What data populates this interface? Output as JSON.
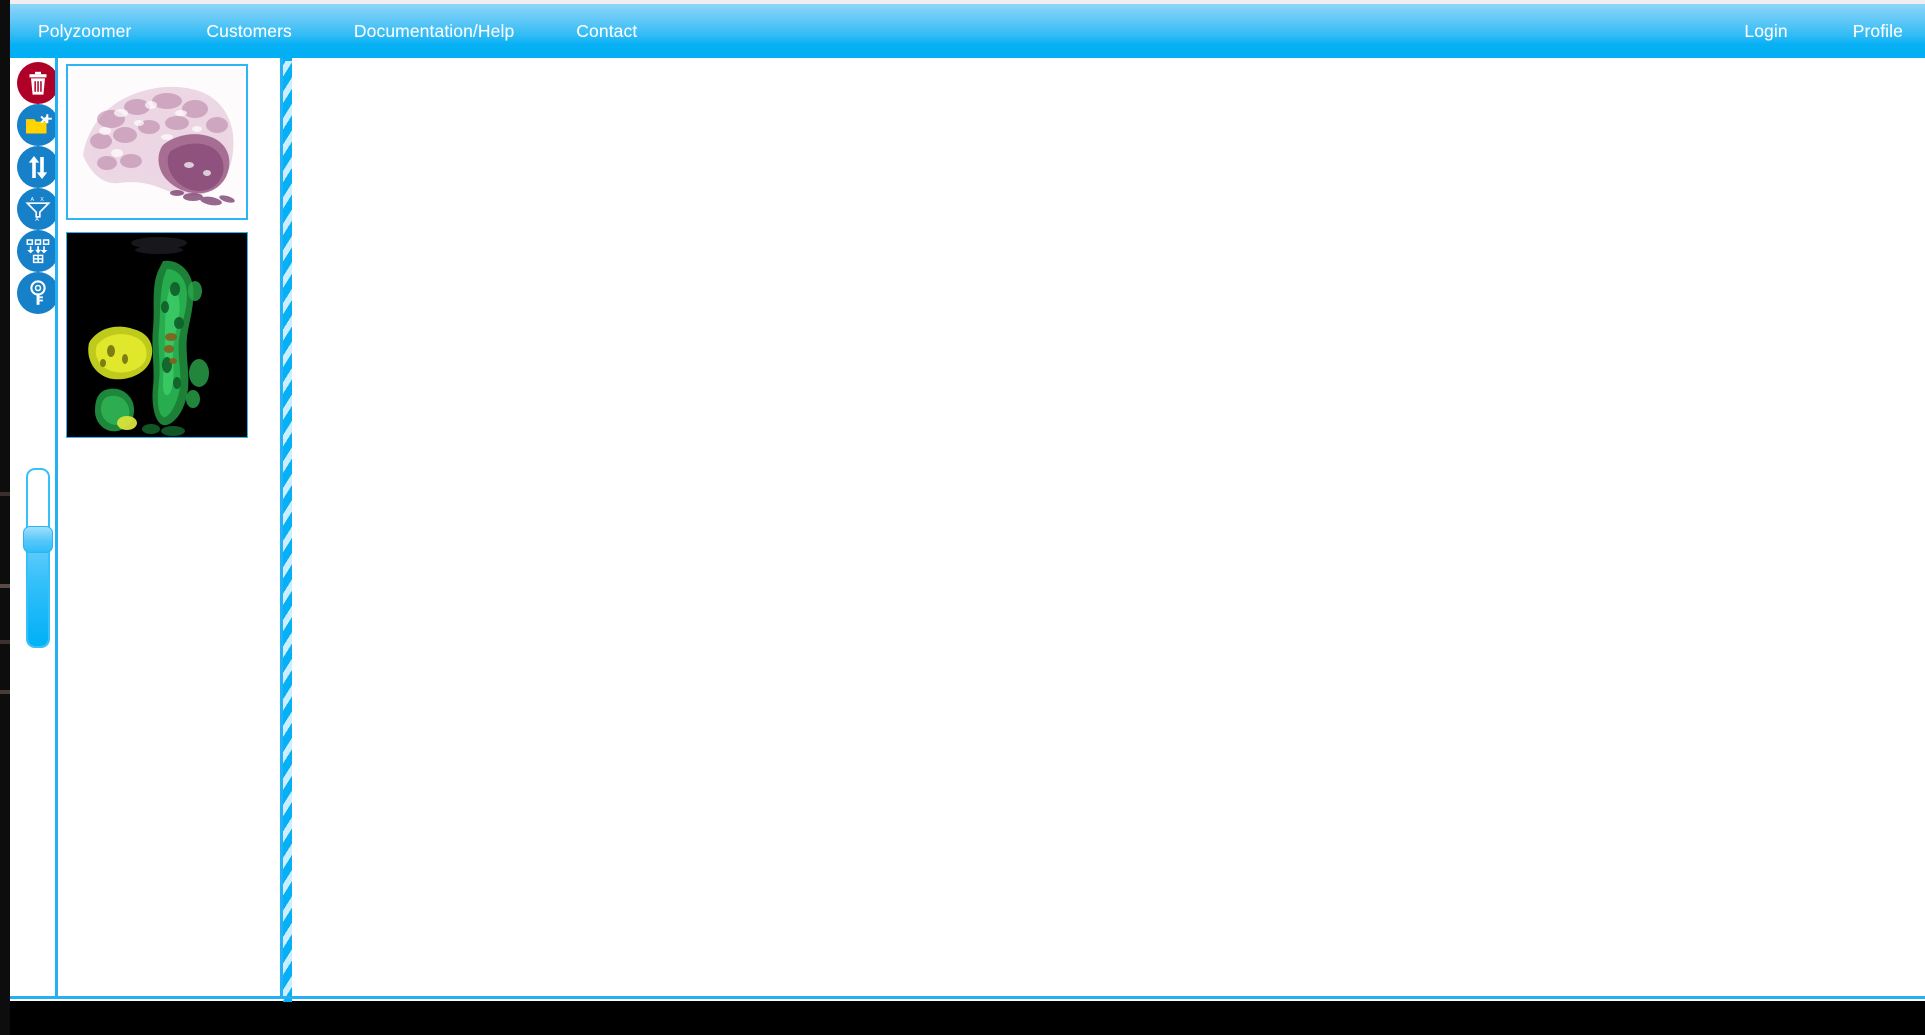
{
  "app": {
    "title": "Polyzoomer",
    "accent_color": "#00aff4",
    "border_color": "#24b1f3",
    "danger_color": "#b10027",
    "tool_color": "#1680c8"
  },
  "navbar": {
    "left_items": [
      {
        "label": "Polyzoomer",
        "name": "nav-item-polyzoomer"
      },
      {
        "label": "Customers",
        "name": "nav-item-customers"
      },
      {
        "label": "Documentation/Help",
        "name": "nav-item-documentation-help"
      },
      {
        "label": "Contact",
        "name": "nav-item-contact"
      }
    ],
    "right_items": [
      {
        "label": "Login",
        "name": "nav-item-login"
      },
      {
        "label": "Profile",
        "name": "nav-item-profile"
      }
    ]
  },
  "toolbar": {
    "buttons": [
      {
        "icon": "trash-icon",
        "label": "Delete",
        "color": "#b10027"
      },
      {
        "icon": "folder-add-icon",
        "label": "Open/Add folder",
        "color": "#1680c8"
      },
      {
        "icon": "sort-arrows-icon",
        "label": "Sort",
        "color": "#1680c8"
      },
      {
        "icon": "filter-funnel-icon",
        "label": "Filter",
        "color": "#1680c8"
      },
      {
        "icon": "merge-grid-icon",
        "label": "Merge to grid",
        "color": "#1680c8"
      },
      {
        "icon": "key-icon",
        "label": "Permissions / key",
        "color": "#1680c8"
      }
    ]
  },
  "zoom_slider": {
    "name": "zoom-slider",
    "orientation": "vertical",
    "value": 68,
    "min": 0,
    "max": 100
  },
  "thumbnails": {
    "panel_label": "Slide thumbnails",
    "items": [
      {
        "name": "thumbnail-slide-he",
        "kind": "brightfield-he-slide",
        "selected": true,
        "alt": "H&E stained tissue section"
      },
      {
        "name": "thumbnail-slide-fluorescence",
        "kind": "fluorescence-slide",
        "selected": false,
        "alt": "Fluorescence scan, green and yellow tissue on black background"
      }
    ]
  },
  "splitter": {
    "name": "panel-splitter",
    "orientation": "vertical"
  },
  "viewer": {
    "name": "slide-viewer-canvas",
    "content": ""
  }
}
